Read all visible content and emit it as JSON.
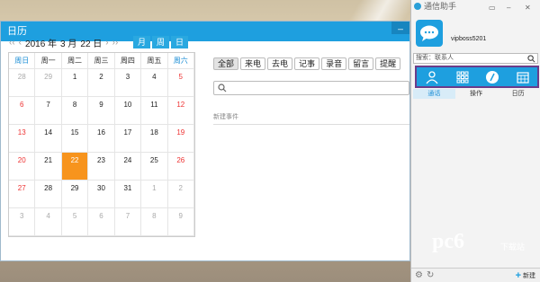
{
  "window": {
    "title": "日历"
  },
  "calendar": {
    "year": "2016 年",
    "month": "3 月",
    "day": "22 日",
    "view_buttons": [
      "月",
      "周",
      "日"
    ],
    "weekdays": [
      "周日",
      "周一",
      "周二",
      "周三",
      "周四",
      "周五",
      "周六"
    ],
    "weeks": [
      [
        "28",
        "29",
        "1",
        "2",
        "3",
        "4",
        "5"
      ],
      [
        "6",
        "7",
        "8",
        "9",
        "10",
        "11",
        "12"
      ],
      [
        "13",
        "14",
        "15",
        "16",
        "17",
        "18",
        "19"
      ],
      [
        "20",
        "21",
        "22",
        "23",
        "24",
        "25",
        "26"
      ],
      [
        "27",
        "28",
        "29",
        "30",
        "31",
        "1",
        "2"
      ],
      [
        "3",
        "4",
        "5",
        "6",
        "7",
        "8",
        "9"
      ]
    ],
    "today": "22",
    "accent_color": "#f7941d"
  },
  "filters": [
    "全部",
    "来电",
    "去电",
    "记事",
    "录音",
    "留言",
    "提醒"
  ],
  "search": {
    "placeholder": ""
  },
  "new_event_label": "新建事件",
  "panel": {
    "title": "通信助手",
    "username": "vipboss5201",
    "search_label": "搜索：联系人",
    "tabs": [
      "contacts-icon",
      "apps-icon",
      "pen-icon",
      "calendar-icon"
    ],
    "subtabs": [
      "通话",
      "操作",
      "日历"
    ],
    "new_label": "新建"
  },
  "watermark": {
    "text": "pc6",
    "sub": "下载站"
  },
  "colors": {
    "brand": "#1e9fdf",
    "highlight_border": "#6b3c8a"
  }
}
